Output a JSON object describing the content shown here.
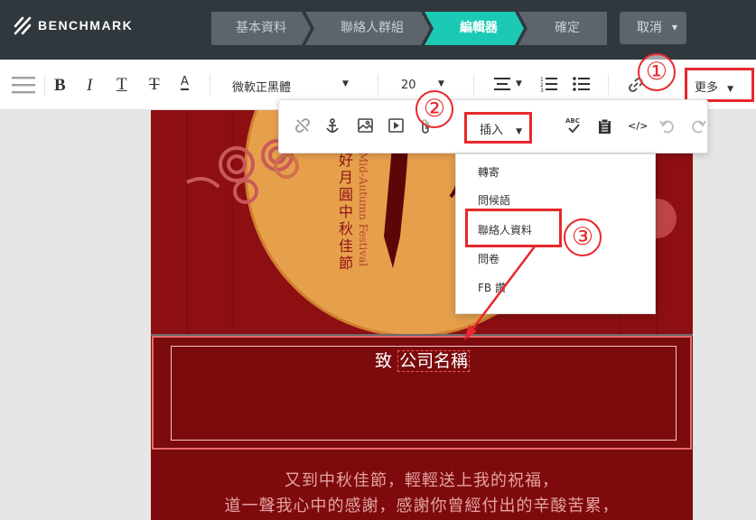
{
  "app": {
    "logo_text": "BENCHMARK"
  },
  "steps": [
    {
      "label": "基本資料",
      "active": false
    },
    {
      "label": "聯絡人群組",
      "active": false
    },
    {
      "label": "編輯器",
      "active": true
    },
    {
      "label": "確定",
      "active": false
    }
  ],
  "cancel_label": "取消",
  "toolbar": {
    "font_family": "微軟正黑體",
    "font_size": "20",
    "more_label": "更多"
  },
  "insert_menu": {
    "label": "插入",
    "items": [
      "轉寄",
      "問候語",
      "聯絡人資料",
      "問卷",
      "FB 讚"
    ]
  },
  "annotations": {
    "one": "①",
    "two": "②",
    "three": "③"
  },
  "colors": {
    "accent": "#1bc9b4",
    "highlight": "#e8282c",
    "canvas": "#7f0a0c"
  },
  "content": {
    "banner_cn": "好月圓中秋佳節",
    "banner_en": "Mid-Autumn Festival",
    "greeting_prefix": "致",
    "company_placeholder": "公司名稱",
    "line1": "又到中秋佳節，輕輕送上我的祝福，",
    "line2": "道一聲我心中的感謝，感謝你曾經付出的辛酸苦累，"
  }
}
